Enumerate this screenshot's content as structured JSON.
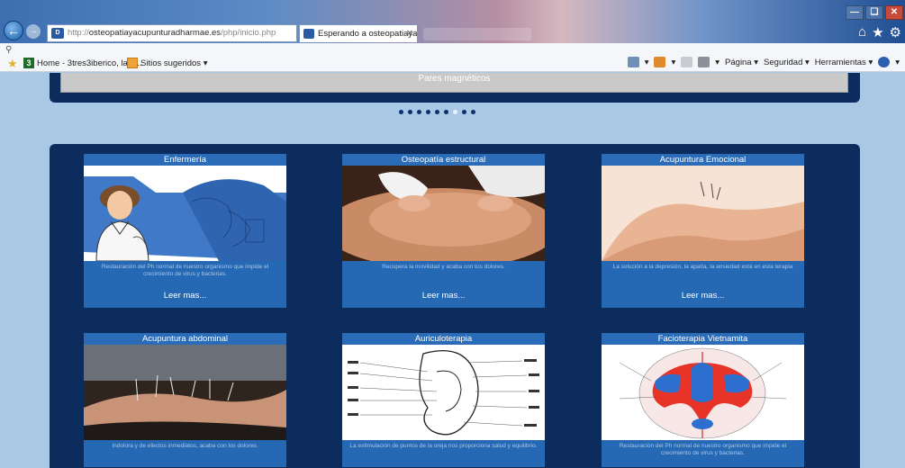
{
  "browser": {
    "address_host": "osteopatiayacupunturadharmae.es",
    "address_prefix": "http://",
    "address_path": "/php/inicio.php",
    "tab_title": "Esperando a osteopatiayac...",
    "favorites": [
      {
        "label": "Home - 3tres3iberico, la p...",
        "icon": "home-3-icon"
      },
      {
        "label": "Sitios sugeridos ▾",
        "icon": "suggested-sites-icon"
      }
    ],
    "commands": [
      "Página ▾",
      "Seguridad ▾",
      "Herramientas ▾"
    ]
  },
  "page": {
    "slider_caption": "Pares magnéticos",
    "dots_total": 9,
    "dots_active": 7,
    "cards": [
      {
        "title": "Enfermería",
        "desc": "Restauración del Ph normal de nuestro organismo que impide el crecimiento de virus y bacterias.",
        "more": "Leer mas..."
      },
      {
        "title": "Osteopatía estructural",
        "desc": "Recupera la movilidad y acaba con tus dolores.",
        "more": "Leer mas..."
      },
      {
        "title": "Acupuntura Emocional",
        "desc": "La solución a la depresión, la apatía, la ansiedad está en esta terapia",
        "more": "Leer mas..."
      },
      {
        "title": "Acupuntura abdominal",
        "desc": "Indolora y de efectos inmediatos, acaba con los dolores.",
        "more": ""
      },
      {
        "title": "Auriculoterapia",
        "desc": "La estimulación de puntos de la oreja nos proporciona salud y equilibrio.",
        "more": ""
      },
      {
        "title": "Facioterapia Vietnamita",
        "desc": "Restauración del Ph normal de nuestro organismo que impide el crecimiento de virus y bacterias.",
        "more": ""
      }
    ]
  }
}
